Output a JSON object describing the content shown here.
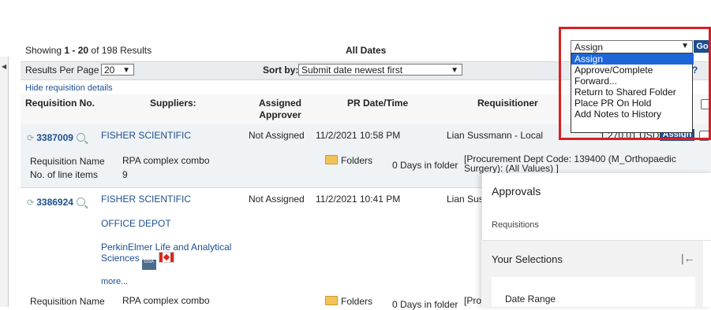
{
  "results": {
    "prefix": "Showing ",
    "range": "1 - 20",
    "suffix": " of 198 Results"
  },
  "date_filter": "All Dates",
  "toolbar": {
    "results_per_page_label": "Results Per Page",
    "results_per_page_value": "20",
    "sort_label": "Sort by:",
    "sort_value": "Submit date newest first",
    "hide_details": "Hide requisition details",
    "help": "?"
  },
  "columns": [
    "Requisition No.",
    "Suppliers:",
    "Assigned Approver",
    "PR Date/Time",
    "Requisitioner"
  ],
  "columns_approver_lines": [
    "Assigned",
    "Approver"
  ],
  "action_dropdown": {
    "selected": "Assign",
    "options": [
      "Assign",
      "Approve/Complete",
      "Forward...",
      "Return to Shared Folder",
      "Place PR On Hold",
      "Add Notes to History"
    ],
    "go_label": "Go"
  },
  "rows": [
    {
      "req_no": "3387009",
      "suppliers": [
        "FISHER SCIENTIFIC"
      ],
      "approver": "Not Assigned",
      "date": "11/2/2021 10:58 PM",
      "requisitioner": "Lian Sussmann - Local",
      "amount": "1,270.01 USD",
      "assign_label": "Assign",
      "name_label": "Requisition Name",
      "name_value": "RPA complex combo",
      "items_label": "No. of line items",
      "items_value": "9",
      "folders_label": "Folders",
      "days_in_folder": "0 Days in folder",
      "dept_line1": "[Procurement Dept Code: 139400 (M_Orthopaedic",
      "dept_line2": "Surgery): (All Values) ]"
    },
    {
      "req_no": "3386924",
      "suppliers": [
        "FISHER SCIENTIFIC",
        "OFFICE DEPOT",
        "PerkinElmer Life and Analytical",
        "Sciences"
      ],
      "approver": "Not Assigned",
      "date": "11/2/2021 10:41 PM",
      "requisitioner": "Lian Sus",
      "more": "more...",
      "gsa_badge": "GSA",
      "name_label": "Requisition Name",
      "name_value": "RPA complex combo",
      "folders_label": "Folders",
      "days_in_folder": "0 Days in folder",
      "dept_fragment": "[Pro"
    }
  ],
  "panel": {
    "title": "Approvals",
    "tab": "Requisitions",
    "section": "Your Selections",
    "collapse_icon": "|←",
    "card": "Date Range"
  },
  "colors": {
    "accent": "#1e4d8f",
    "highlight": "#d62025",
    "selected_option": "#1e66d8"
  }
}
